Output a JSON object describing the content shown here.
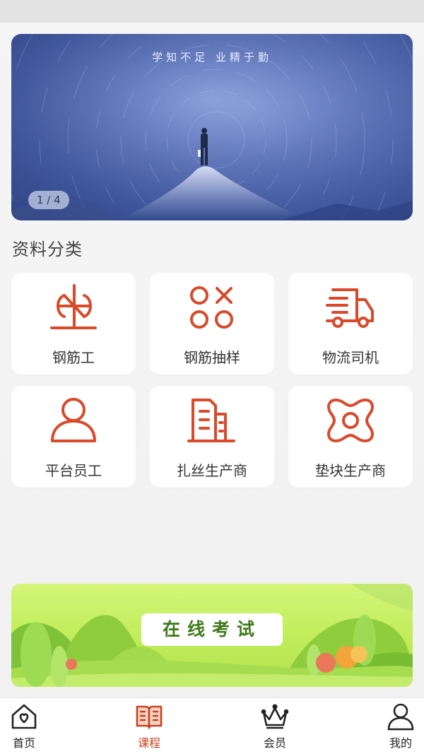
{
  "banner": {
    "slogan": "学知不足 业精于勤",
    "pager": "1 / 4"
  },
  "section": {
    "title": "资料分类"
  },
  "categories": [
    {
      "label": "钢筋工",
      "icon": "rebar-worker-icon"
    },
    {
      "label": "钢筋抽样",
      "icon": "shapes-icon"
    },
    {
      "label": "物流司机",
      "icon": "truck-icon"
    },
    {
      "label": "平台员工",
      "icon": "person-icon"
    },
    {
      "label": "扎丝生产商",
      "icon": "building-icon"
    },
    {
      "label": "垫块生产商",
      "icon": "block-icon"
    }
  ],
  "exam": {
    "label": "在线考试"
  },
  "tabbar": {
    "items": [
      {
        "label": "首页",
        "icon": "home-icon",
        "active": false
      },
      {
        "label": "课程",
        "icon": "book-icon",
        "active": true
      },
      {
        "label": "会员",
        "icon": "crown-icon",
        "active": false
      },
      {
        "label": "我的",
        "icon": "user-icon",
        "active": false
      }
    ]
  },
  "colors": {
    "accent": "#d9492a",
    "active_tab": "#c9421e"
  }
}
